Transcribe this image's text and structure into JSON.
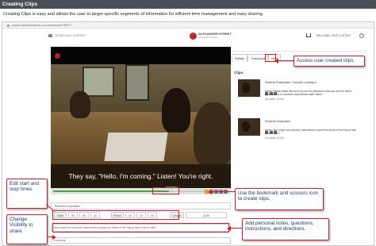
{
  "page": {
    "title": "Creating Clips",
    "subtitle": "Creating Clips is easy and allows the user to target specific segments of information for efficient time management and easy sharing."
  },
  "browser": {
    "url": "search.alexanderstreet.com/view/work/2780177"
  },
  "site_header": {
    "search_link": "SEARCH ALL CONTENT",
    "logo_line1": "ALEXANDER STREET",
    "logo_line2": "a ProQuest Company",
    "welcome": "WELCOME, USER CONTENT",
    "help": "?",
    "back_link": "< Dashboard  /  View work"
  },
  "video": {
    "caption": "They say, \"Hello, I'm coming.\" Listen! You're right.",
    "progress_fraction": 0.68
  },
  "clip_form": {
    "title_value": "Reverse Exploration",
    "start_label": "Start",
    "start_values": [
      "00",
      "00",
      "20"
    ],
    "finish_label": "Finish",
    "finish_values": [
      "00",
      "01",
      "05"
    ],
    "length_label": "Length",
    "length_value": "11:56",
    "notes_value": "How might the explorers' observations impact the future of the Papua New Guinea tribe?",
    "visibility_value": "Everyone"
  },
  "side_panel": {
    "tabs": [
      "Details",
      "Transcript",
      "Clips"
    ],
    "active_tab": "Clips",
    "clips_heading": "Clips",
    "clips": [
      {
        "title": "Reverse Exploration: Outsider Looking In",
        "note": "Notes: Please watch this short clip and be prepared to discuss how the tribe's appearances to outsiders dependents make matter.",
        "duration": "(Duration: 11:56)"
      },
      {
        "title": "Reverse Exploration",
        "note": "Notes: How might the explorers' observations impact the future of the Papua New Guinea tribe?",
        "duration": "(Duration: 11:56)"
      }
    ]
  },
  "callouts": {
    "access_clips": "Access user created clips.",
    "edit_times": "Edit start and stop times",
    "bookmark": "Use the bookmark and scissors icon to create clips.",
    "change_visibility": "Change Visibility to share",
    "personal_notes": "Add personal notes, questions, instructions, and directions."
  },
  "colors": {
    "callout_border": "#d21f26",
    "callout_text": "#1d3a73",
    "brand_red": "#c0272d",
    "progress_green": "#4ba245"
  }
}
